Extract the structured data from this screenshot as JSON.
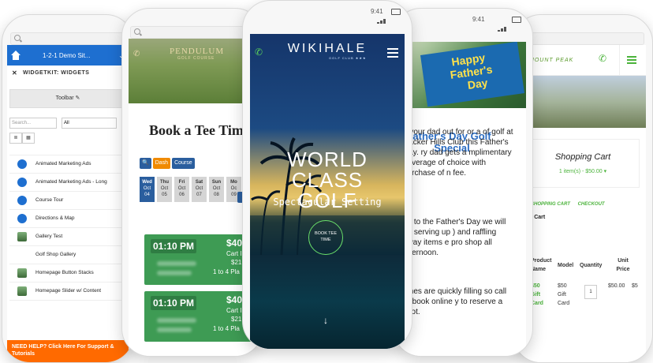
{
  "status_time": "9:41",
  "phone1": {
    "header_title": "1-2-1 Demo Sit...",
    "chevron": "⌄",
    "section_title": "WIDGETKIT: WIDGETS",
    "toolbar_label": "Toolbar",
    "search_placeholder": "Search...",
    "filter_value": "All",
    "items": [
      {
        "label": "Animated Marketing Ads",
        "icon": "blue-circle"
      },
      {
        "label": "Animated Marketing Ads - Long",
        "icon": "blue-circle"
      },
      {
        "label": "Course Tour",
        "icon": "blue-circle"
      },
      {
        "label": "Directions & Map",
        "icon": "blue-circle"
      },
      {
        "label": "Gallery Test",
        "icon": "image-thumb"
      },
      {
        "label": "Golf Shop Gallery",
        "icon": "none"
      },
      {
        "label": "Homepage Button Stacks",
        "icon": "image-thumb"
      },
      {
        "label": "Homepage Slider w/ Content",
        "icon": "image-thumb"
      }
    ],
    "help_text": "NEED HELP? Click Here For Support & Tutorials"
  },
  "phone2": {
    "logo": "PENDULUM",
    "logo_sub": "GOLF COURSE",
    "title": "Book a Tee Tim",
    "btn_dash": "Dash",
    "btn_course": "Course",
    "dates": [
      {
        "d": "Wed",
        "m": "Oct",
        "n": "04"
      },
      {
        "d": "Thu",
        "m": "Oct",
        "n": "05"
      },
      {
        "d": "Fri",
        "m": "Oct",
        "n": "06"
      },
      {
        "d": "Sat",
        "m": "Oct",
        "n": "07"
      },
      {
        "d": "Sun",
        "m": "Oct",
        "n": "08"
      },
      {
        "d": "Mo",
        "m": "Oc",
        "n": "09"
      }
    ],
    "slots": [
      {
        "time": "01:10 PM",
        "price": "$40",
        "cart": "Cart I",
        "cart_price": "$21",
        "players": "1 to 4 Pla"
      },
      {
        "time": "01:10 PM",
        "price": "$40",
        "cart": "Cart I",
        "cart_price": "$21",
        "players": "1 to 4 Pla"
      }
    ]
  },
  "phone3": {
    "logo": "WIKIHALE",
    "logo_sub": "GOLF CLUB ★★★",
    "headline_line1": "WORLD CLASS",
    "headline_line2": "GOLF",
    "subheadline": "Spectacular Setting",
    "cta_line1": "BOOK TEE",
    "cta_line2": "TIME",
    "scroll_arrow": "↓",
    "accent_color": "#6ae06a"
  },
  "phone4": {
    "card_line1": "Happy",
    "card_line2": "Father's",
    "card_line3": "Day",
    "title_line1": "ather's Day Golf",
    "title_line2": "Special",
    "para1": "e your dad out for or a  of golf at Hacker Hills  Club this Father's Day.  ry dad gets a  mplimentary beverage of  choice with purchase of  n fee.",
    "para2": "dd to the Father's Day  we will be serving up  ) and raffling away items  e pro shop all afternoon.",
    "para3": "times are quickly filling  so call or book online  y to reserve a spot."
  },
  "phone5": {
    "logo": "MOUNT PEAK",
    "cart_title": "Shopping Cart",
    "cart_summary": "1 item(s) - $50.00 ▾",
    "link1": "SHOPPING CART",
    "link2": "CHECKOUT",
    "section": "g Cart",
    "col_product": "Product Name",
    "col_model": "Model",
    "col_qty": "Quantity",
    "col_unit": "Unit Price",
    "item_name": "$50 Gift Card",
    "item_model": "$50 Gift Card",
    "item_qty": "1",
    "item_price": "$50.00",
    "item_total": "$5",
    "accent_color": "#4bb33b"
  }
}
